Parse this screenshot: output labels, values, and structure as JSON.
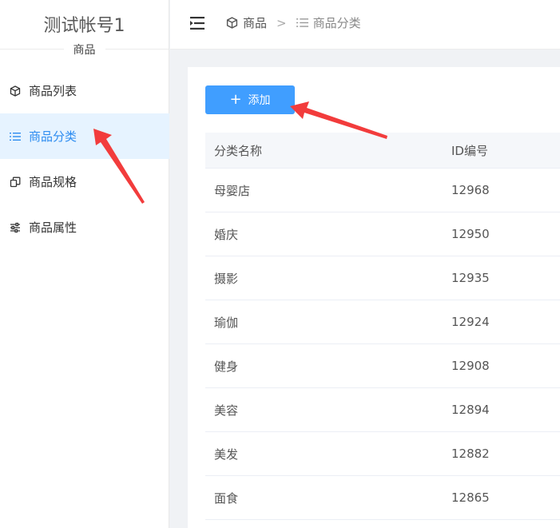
{
  "sidebar": {
    "account_name": "测试帐号1",
    "account_sub": "商品",
    "items": [
      {
        "label": "商品列表",
        "icon": "box-icon",
        "active": false
      },
      {
        "label": "商品分类",
        "icon": "list-icon",
        "active": true
      },
      {
        "label": "商品规格",
        "icon": "copy-icon",
        "active": false
      },
      {
        "label": "商品属性",
        "icon": "sliders-icon",
        "active": false
      }
    ]
  },
  "header": {
    "collapse_icon": "menu-fold-icon",
    "breadcrumb": [
      {
        "label": "商品",
        "icon": "box-icon"
      },
      {
        "label": "商品分类",
        "icon": "list-icon"
      }
    ],
    "separator": ">"
  },
  "main": {
    "add_button": {
      "label": "添加",
      "icon": "plus-icon"
    },
    "table": {
      "columns": [
        "分类名称",
        "ID编号"
      ],
      "rows": [
        {
          "name": "母婴店",
          "id": "12968"
        },
        {
          "name": "婚庆",
          "id": "12950"
        },
        {
          "name": "摄影",
          "id": "12935"
        },
        {
          "name": "瑜伽",
          "id": "12924"
        },
        {
          "name": "健身",
          "id": "12908"
        },
        {
          "name": "美容",
          "id": "12894"
        },
        {
          "name": "美发",
          "id": "12882"
        },
        {
          "name": "面食",
          "id": "12865"
        }
      ]
    }
  },
  "colors": {
    "accent": "#409eff",
    "active_text": "#2d8cf0",
    "active_bg": "#e6f3ff",
    "annotation_arrow": "#f23c3c"
  }
}
